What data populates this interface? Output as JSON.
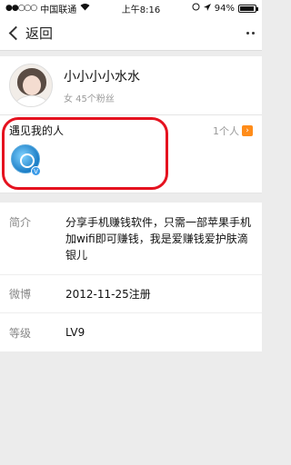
{
  "status_bar": {
    "carrier": "中国联通",
    "time": "上午8:16",
    "battery": "94%",
    "battery_level": 0.94
  },
  "nav": {
    "back_label": "返回"
  },
  "profile": {
    "nickname": "小小小小水水",
    "meta": "女 45个粉丝"
  },
  "met": {
    "title": "遇见我的人",
    "count": "1个人",
    "badge": "V"
  },
  "info": {
    "intro_label": "简介",
    "intro_value": "分享手机赚钱软件，只需一部苹果手机加wifi即可赚钱，我是爱赚钱爱护肤滴银儿",
    "weibo_label": "微博",
    "weibo_value": "2012-11-25注册",
    "level_label": "等级",
    "level_value": "LV9"
  },
  "colors": {
    "accent_orange": "#ff8c1a",
    "highlight_red": "#e5121f"
  },
  "icons": [
    "signal-dots-icon",
    "wifi-icon",
    "location-icon",
    "battery-icon",
    "back-chevron-icon",
    "more-icon",
    "arrow-right-icon",
    "verified-badge-icon"
  ]
}
